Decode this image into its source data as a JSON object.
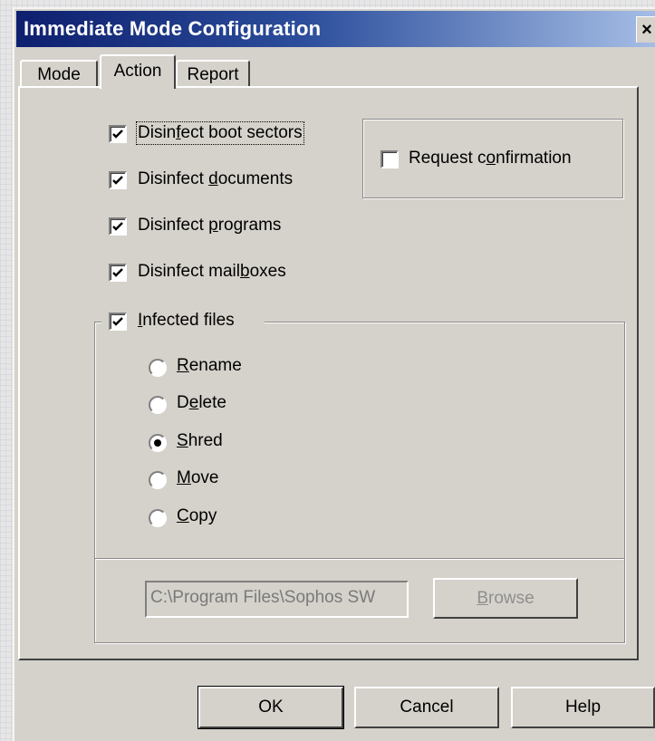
{
  "window": {
    "title": "Immediate Mode Configuration",
    "close_glyph": "×"
  },
  "tabs": [
    {
      "label": "Mode"
    },
    {
      "label": "Action",
      "active": true
    },
    {
      "label": "Report"
    }
  ],
  "disinfect": {
    "boot_sectors": {
      "pre": "Disin",
      "u": "f",
      "post": "ect boot sectors",
      "checked": true
    },
    "documents": {
      "pre": "Disinfect ",
      "u": "d",
      "post": "ocuments",
      "checked": true
    },
    "programs": {
      "pre": "Disinfect ",
      "u": "p",
      "post": "rograms",
      "checked": true
    },
    "mailboxes": {
      "pre": "Disinfect mail",
      "u": "b",
      "post": "oxes",
      "checked": true
    }
  },
  "request_confirmation": {
    "pre": "Request c",
    "u": "o",
    "post": "nfirmation",
    "checked": false
  },
  "infected_files": {
    "pre": "",
    "u": "I",
    "post": "nfected files",
    "checked": true,
    "options": [
      {
        "pre": "",
        "u": "R",
        "post": "ename",
        "selected": false
      },
      {
        "pre": "D",
        "u": "e",
        "post": "lete",
        "selected": false
      },
      {
        "pre": "",
        "u": "S",
        "post": "hred",
        "selected": true
      },
      {
        "pre": "",
        "u": "M",
        "post": "ove",
        "selected": false
      },
      {
        "pre": "",
        "u": "C",
        "post": "opy",
        "selected": false
      }
    ],
    "path_value": "C:\\Program Files\\Sophos SW",
    "browse": {
      "pre": "",
      "u": "B",
      "post": "rowse"
    }
  },
  "buttons": {
    "ok": "OK",
    "cancel": "Cancel",
    "help": "Help"
  }
}
